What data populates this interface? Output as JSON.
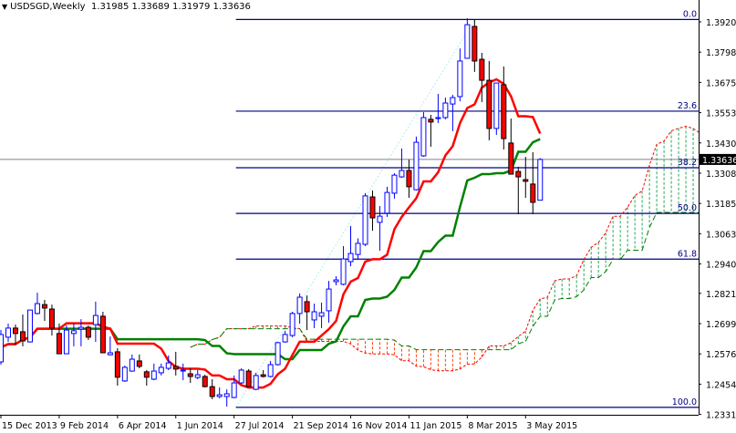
{
  "header": {
    "symbol": "USDSGD,Weekly",
    "values": "1.31985 1.33689 1.31979 1.33636"
  },
  "colors": {
    "bull": "#0000ff",
    "bear_fill": "#ff0000",
    "tenkan": "#ff0000",
    "kijun": "#008000",
    "span_a": "#ff0000",
    "span_b": "#008000",
    "fib": "#000080",
    "fib_base": "#aeeeee",
    "price_line": "#808080"
  },
  "chart_data": {
    "type": "candlestick",
    "title": "USDSGD,Weekly",
    "indicator": "Ichimoku Kinko Hyo",
    "ichimoku_periods": {
      "tenkan": 9,
      "kijun": 26,
      "senkou_b": 52
    },
    "ylim": [
      1.2278,
      1.4009
    ],
    "price_ticks": [
      "1.39205",
      "1.37980",
      "1.36755",
      "1.35530",
      "1.34305",
      "1.33080",
      "1.31855",
      "1.30630",
      "1.29405",
      "1.28215",
      "1.26990",
      "1.25765",
      "1.24540",
      "1.23315"
    ],
    "current_price": "1.33636",
    "date_labels": [
      {
        "index": 0,
        "label": "15 Dec 2013"
      },
      {
        "index": 8,
        "label": "9 Feb 2014"
      },
      {
        "index": 16,
        "label": "6 Apr 2014"
      },
      {
        "index": 24,
        "label": "1 Jun 2014"
      },
      {
        "index": 32,
        "label": "27 Jul 2014"
      },
      {
        "index": 40,
        "label": "21 Sep 2014"
      },
      {
        "index": 48,
        "label": "16 Nov 2014"
      },
      {
        "index": 56,
        "label": "11 Jan 2015"
      },
      {
        "index": 64,
        "label": "8 Mar 2015"
      },
      {
        "index": 72,
        "label": "3 May 2015"
      }
    ],
    "fibonacci": {
      "high": 1.393,
      "low": 1.236,
      "high_index": 65,
      "low_index": 32,
      "levels": [
        {
          "label": "0.0",
          "price": 1.393
        },
        {
          "label": "23.6",
          "price": 1.3559
        },
        {
          "label": "38.2",
          "price": 1.333
        },
        {
          "label": "50.0",
          "price": 1.3145
        },
        {
          "label": "61.8",
          "price": 1.296
        },
        {
          "label": "100.0",
          "price": 1.236
        }
      ]
    },
    "ohlc": [
      [
        1.2544,
        1.2673,
        1.2533,
        1.2655
      ],
      [
        1.2644,
        1.2699,
        1.2625,
        1.2681
      ],
      [
        1.2681,
        1.2695,
        1.2614,
        1.2659
      ],
      [
        1.2666,
        1.2736,
        1.2607,
        1.2629
      ],
      [
        1.2625,
        1.2754,
        1.2622,
        1.2754
      ],
      [
        1.274,
        1.2824,
        1.2736,
        1.278
      ],
      [
        1.2776,
        1.2795,
        1.271,
        1.2762
      ],
      [
        1.2758,
        1.2776,
        1.2651,
        1.2681
      ],
      [
        1.2659,
        1.2699,
        1.2577,
        1.2577
      ],
      [
        1.2577,
        1.2692,
        1.2577,
        1.2673
      ],
      [
        1.2659,
        1.2699,
        1.2607,
        1.267
      ],
      [
        1.2677,
        1.2717,
        1.2607,
        1.2684
      ],
      [
        1.2684,
        1.2692,
        1.2633,
        1.2644
      ],
      [
        1.2695,
        1.2788,
        1.2625,
        1.2732
      ],
      [
        1.2729,
        1.2747,
        1.2581,
        1.2581
      ],
      [
        1.2573,
        1.2647,
        1.257,
        1.2581
      ],
      [
        1.2585,
        1.26,
        1.2448,
        1.2482
      ],
      [
        1.2467,
        1.2529,
        1.2463,
        1.2522
      ],
      [
        1.2507,
        1.2574,
        1.2504,
        1.2555
      ],
      [
        1.2548,
        1.2574,
        1.2518,
        1.2526
      ],
      [
        1.2504,
        1.2511,
        1.2448,
        1.2482
      ],
      [
        1.2474,
        1.2537,
        1.247,
        1.2507
      ],
      [
        1.25,
        1.2537,
        1.2489,
        1.2522
      ],
      [
        1.2518,
        1.257,
        1.2511,
        1.254
      ],
      [
        1.2526,
        1.2585,
        1.2489,
        1.2515
      ],
      [
        1.2507,
        1.2537,
        1.247,
        1.2511
      ],
      [
        1.2496,
        1.2518,
        1.2459,
        1.2485
      ],
      [
        1.2481,
        1.2511,
        1.2474,
        1.2492
      ],
      [
        1.2485,
        1.2492,
        1.2441,
        1.2444
      ],
      [
        1.2444,
        1.2474,
        1.2393,
        1.2404
      ],
      [
        1.2404,
        1.2441,
        1.2397,
        1.2411
      ],
      [
        1.2404,
        1.2433,
        1.2363,
        1.2415
      ],
      [
        1.24,
        1.2489,
        1.2397,
        1.2459
      ],
      [
        1.2459,
        1.2518,
        1.2455,
        1.2511
      ],
      [
        1.2507,
        1.2515,
        1.2444,
        1.2444
      ],
      [
        1.2433,
        1.25,
        1.243,
        1.2489
      ],
      [
        1.2492,
        1.2511,
        1.2481,
        1.2485
      ],
      [
        1.2485,
        1.2548,
        1.2481,
        1.2533
      ],
      [
        1.2533,
        1.2625,
        1.2529,
        1.2622
      ],
      [
        1.2625,
        1.267,
        1.2622,
        1.2655
      ],
      [
        1.2651,
        1.2747,
        1.2644,
        1.274
      ],
      [
        1.274,
        1.2821,
        1.2699,
        1.2806
      ],
      [
        1.2788,
        1.2813,
        1.2673,
        1.2747
      ],
      [
        1.2714,
        1.278,
        1.2681,
        1.2747
      ],
      [
        1.2729,
        1.2784,
        1.2681,
        1.2743
      ],
      [
        1.2751,
        1.2872,
        1.2703,
        1.2839
      ],
      [
        1.2869,
        1.2891,
        1.2854,
        1.2876
      ],
      [
        1.2858,
        1.3013,
        1.2854,
        1.2961
      ],
      [
        1.295,
        1.3094,
        1.2931,
        1.2983
      ],
      [
        1.2979,
        1.3044,
        1.2957,
        1.3024
      ],
      [
        1.302,
        1.3227,
        1.3013,
        1.3216
      ],
      [
        1.3212,
        1.3238,
        1.3075,
        1.3127
      ],
      [
        1.3109,
        1.3175,
        1.2994,
        1.3134
      ],
      [
        1.3146,
        1.3253,
        1.3131,
        1.323
      ],
      [
        1.3227,
        1.3308,
        1.3205,
        1.33
      ],
      [
        1.3293,
        1.3408,
        1.3289,
        1.3319
      ],
      [
        1.3319,
        1.3363,
        1.3208,
        1.3253
      ],
      [
        1.3241,
        1.3456,
        1.3238,
        1.3433
      ],
      [
        1.3378,
        1.3555,
        1.3374,
        1.3533
      ],
      [
        1.3526,
        1.3544,
        1.3415,
        1.3515
      ],
      [
        1.3529,
        1.3629,
        1.3511,
        1.3533
      ],
      [
        1.3533,
        1.3614,
        1.3526,
        1.3592
      ],
      [
        1.3588,
        1.3625,
        1.3478,
        1.3614
      ],
      [
        1.3618,
        1.3813,
        1.3599,
        1.3762
      ],
      [
        1.3773,
        1.3935,
        1.3773,
        1.3909
      ],
      [
        1.3902,
        1.3928,
        1.3718,
        1.3762
      ],
      [
        1.3769,
        1.3795,
        1.3596,
        1.3684
      ],
      [
        1.3684,
        1.3762,
        1.3441,
        1.3489
      ],
      [
        1.3489,
        1.3673,
        1.3463,
        1.3673
      ],
      [
        1.3666,
        1.374,
        1.3404,
        1.3448
      ],
      [
        1.343,
        1.3529,
        1.3304,
        1.3304
      ],
      [
        1.3315,
        1.3334,
        1.3142,
        1.3293
      ],
      [
        1.3282,
        1.3374,
        1.3208,
        1.3275
      ],
      [
        1.3264,
        1.3393,
        1.3142,
        1.319
      ],
      [
        1.31985,
        1.33689,
        1.31979,
        1.33636
      ]
    ]
  }
}
